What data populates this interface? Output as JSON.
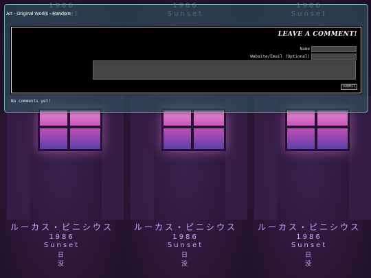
{
  "breadcrumb": {
    "part1": "Art",
    "sep1": " - ",
    "part2": "Original Works",
    "sep2": " - ",
    "part3": "Random"
  },
  "comment_form": {
    "title": "LEAVE A COMMENT!",
    "name_label": "Name",
    "website_label": "Website/Email (Optional)",
    "submit_label": "SUBMIT"
  },
  "comments": {
    "empty_text": "No comments yet!"
  },
  "background_art": {
    "kana": "ルーカス・ピニシウス",
    "year": "1986",
    "word": "Sunset",
    "kanji1": "日",
    "kanji2": "没"
  },
  "colors": {
    "panel": "#305c64",
    "accent_text": "#c9a8ff",
    "window_glow": "#e58bd0"
  }
}
